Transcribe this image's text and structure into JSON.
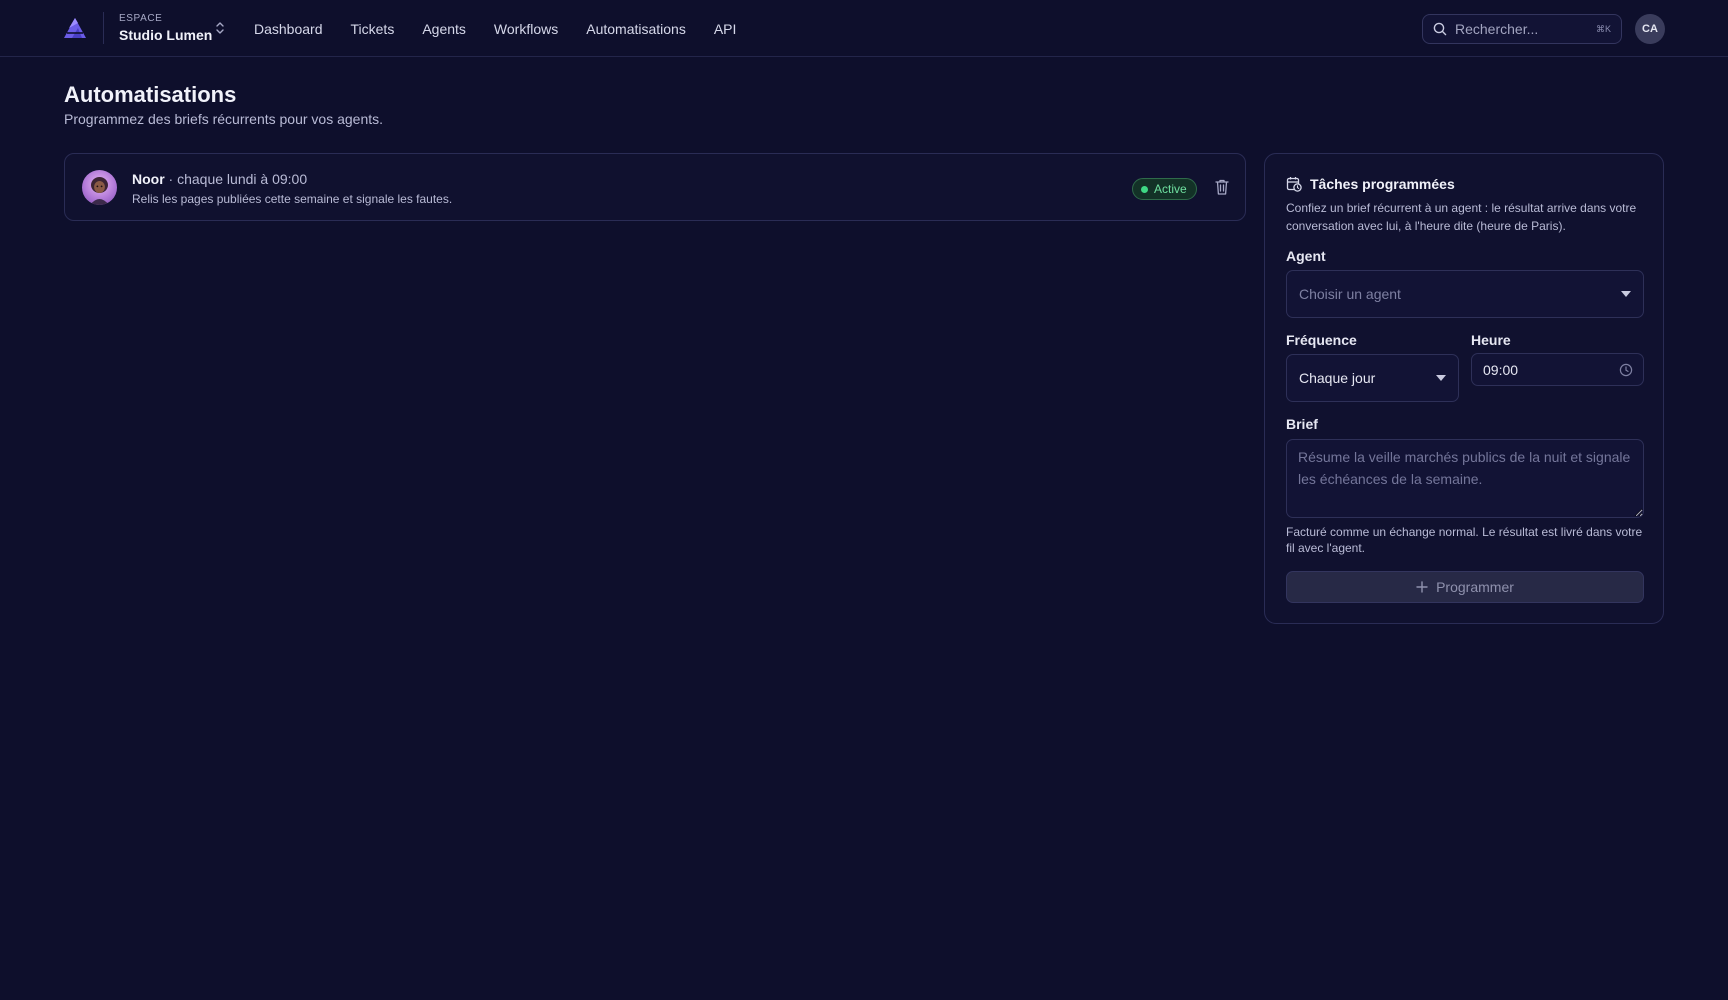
{
  "header": {
    "workspace_label": "ESPACE",
    "workspace_name": "Studio Lumen",
    "nav": [
      "Dashboard",
      "Tickets",
      "Agents",
      "Workflows",
      "Automatisations",
      "API"
    ],
    "search_placeholder": "Rechercher...",
    "search_shortcut": "⌘K",
    "user_initials": "CA"
  },
  "page": {
    "title": "Automatisations",
    "subtitle": "Programmez des briefs récurrents pour vos agents."
  },
  "tasks": [
    {
      "agent": "Noor",
      "schedule": " · chaque lundi à 09:00",
      "description": "Relis les pages publiées cette semaine et signale les fautes.",
      "status": "Active"
    }
  ],
  "form": {
    "title": "Tâches programmées",
    "description": "Confiez un brief récurrent à un agent : le résultat arrive dans votre conversation avec lui, à l'heure dite (heure de Paris).",
    "agent_label": "Agent",
    "agent_placeholder": "Choisir un agent",
    "frequency_label": "Fréquence",
    "frequency_value": "Chaque jour",
    "time_label": "Heure",
    "time_value": "09:00",
    "brief_label": "Brief",
    "brief_placeholder": "Résume la veille marchés publics de la nuit et signale les échéances de la semaine.",
    "billing_note": "Facturé comme un échange normal. Le résultat est livré dans votre fil avec l'agent.",
    "submit_label": "Programmer"
  },
  "colors": {
    "background": "#0e0f2c",
    "accent": "#7b6cf0",
    "status_active": "#3ed884"
  }
}
